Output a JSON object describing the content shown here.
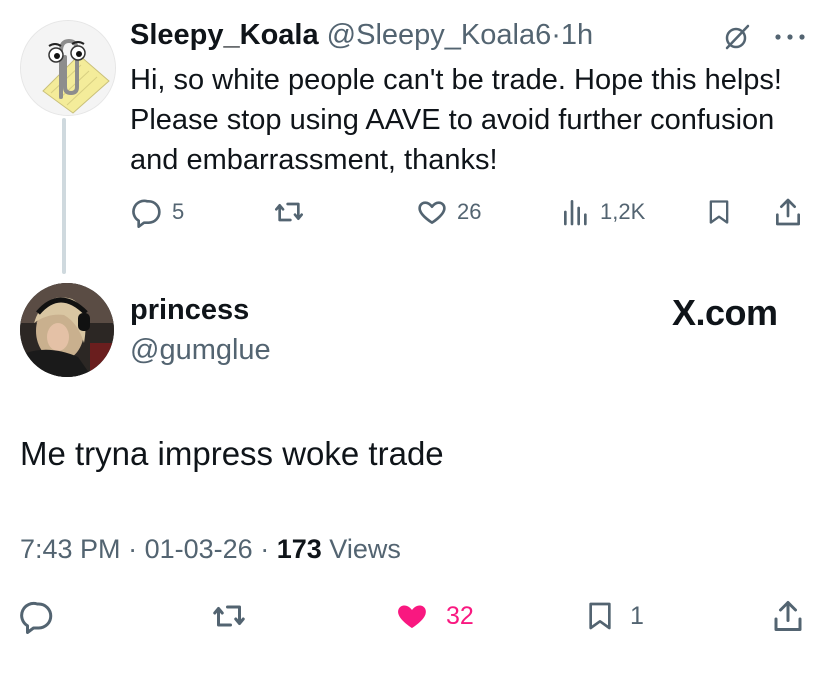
{
  "reply": {
    "name": "Sleepy_Koala",
    "handle": "@Sleepy_Koala6",
    "separator": "·",
    "time": "1h",
    "text": "Hi, so white people can't be trade. Hope this helps! Please stop using AAVE to avoid further confusion and embarrassment, thanks!",
    "stats": {
      "replies": "5",
      "reposts": "",
      "likes": "26",
      "views": "1,2K"
    },
    "icons": [
      "grok-icon",
      "more-icon",
      "reply-icon",
      "repost-icon",
      "like-icon",
      "views-icon",
      "bookmark-icon",
      "share-icon"
    ]
  },
  "post": {
    "name": "princess",
    "handle": "@gumglue",
    "watermark": "X.com",
    "text": "Me tryna impress woke trade",
    "time": "7:43 PM",
    "date": "01-03-26",
    "separator": "·",
    "views_count": "173",
    "views_label": "Views",
    "stats": {
      "replies": "",
      "reposts": "",
      "likes": "32",
      "bookmarks": "1"
    },
    "liked": true,
    "icons": [
      "reply-icon",
      "repost-icon",
      "heart-filled-icon",
      "bookmark-icon",
      "share-icon"
    ]
  },
  "colors": {
    "text": "#0f1419",
    "muted": "#536471",
    "like": "#f91880",
    "thread_line": "#cfd9de"
  }
}
